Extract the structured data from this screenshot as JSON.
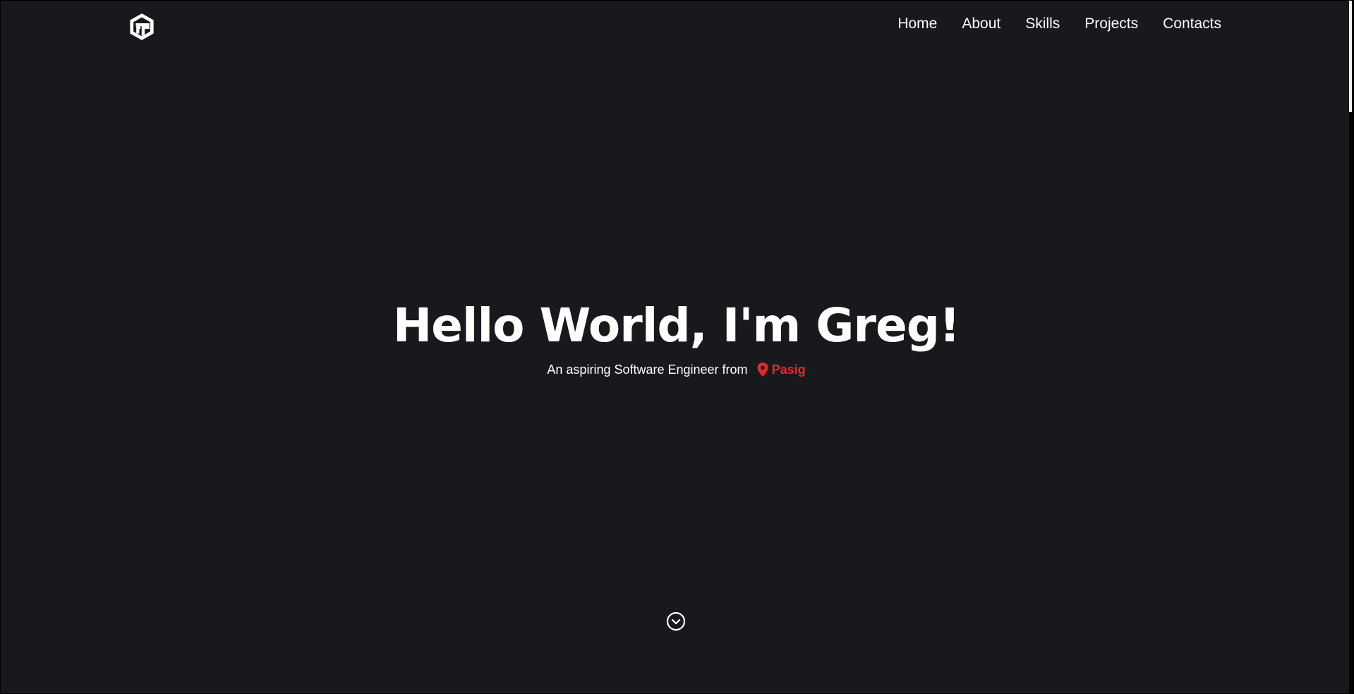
{
  "nav": {
    "logo_icon": "gg-hexagon-logo-icon",
    "links": [
      "Home",
      "About",
      "Skills",
      "Projects",
      "Contacts"
    ]
  },
  "hero": {
    "title": "Hello World, I'm Greg!",
    "subtitle": "An aspiring Software Engineer from",
    "location": "Pasig",
    "location_icon": "map-pin-icon",
    "location_color": "#e5292e"
  },
  "scroll_icon": "chevron-down-circle-icon",
  "colors": {
    "background": "#18191d",
    "text": "#ffffff",
    "accent": "#e5292e"
  }
}
